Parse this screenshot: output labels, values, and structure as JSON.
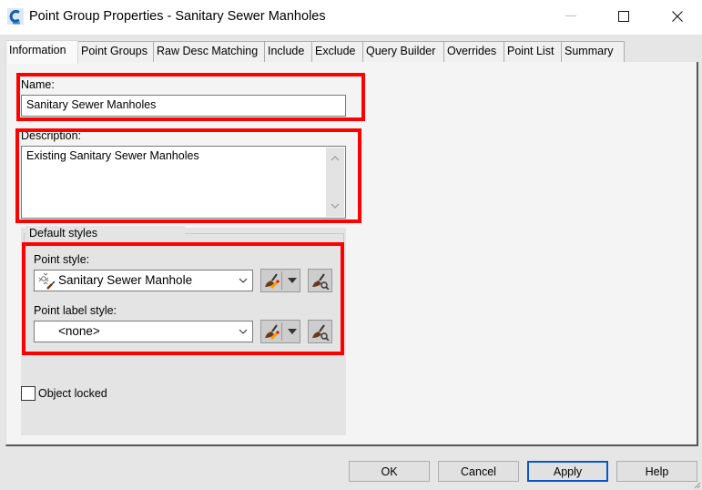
{
  "window": {
    "title": "Point Group Properties - Sanitary Sewer Manholes",
    "app_icon": "civil3d-app-icon",
    "controls": [
      "minimize",
      "maximize",
      "close"
    ]
  },
  "tabs": [
    {
      "label": "Information",
      "active": true
    },
    {
      "label": "Point Groups",
      "active": false
    },
    {
      "label": "Raw Desc Matching",
      "active": false
    },
    {
      "label": "Include",
      "active": false
    },
    {
      "label": "Exclude",
      "active": false
    },
    {
      "label": "Query Builder",
      "active": false
    },
    {
      "label": "Overrides",
      "active": false
    },
    {
      "label": "Point List",
      "active": false
    },
    {
      "label": "Summary",
      "active": false
    }
  ],
  "info": {
    "name_label": "Name:",
    "name_value": "Sanitary Sewer Manholes",
    "description_label": "Description:",
    "description_value": "Existing Sanitary Sewer Manholes",
    "default_styles_label": "Default styles",
    "point_style_label": "Point style:",
    "point_style_value": "Sanitary Sewer Manhole",
    "point_label_style_label": "Point label style:",
    "point_label_style_value": "<none>",
    "object_locked_label": "Object locked",
    "object_locked": false
  },
  "highlight_color": "#ff0000",
  "buttons": {
    "ok": "OK",
    "cancel": "Cancel",
    "apply": "Apply",
    "help": "Help"
  }
}
